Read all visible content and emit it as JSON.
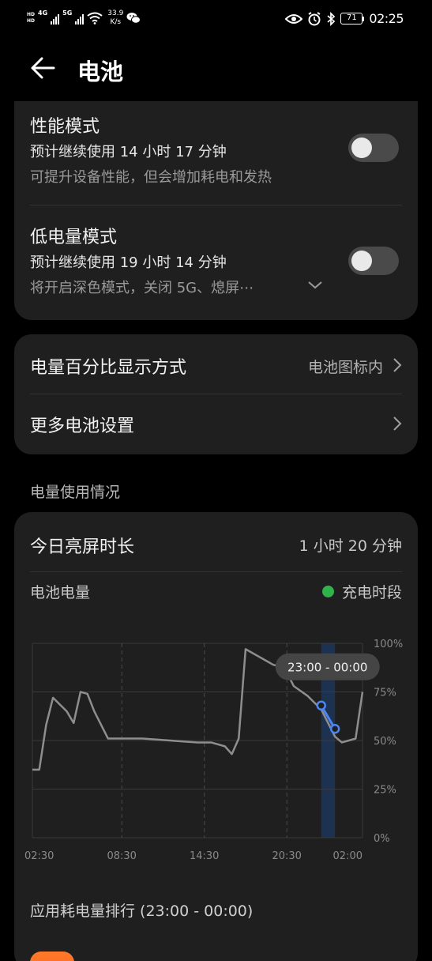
{
  "status_bar": {
    "hd1": "HD",
    "hd2": "HD",
    "sim1": "4G",
    "sim2": "5G",
    "speed_value": "33.9",
    "speed_unit": "K/s",
    "battery_level": "71",
    "time": "02:25"
  },
  "header": {
    "title": "电池"
  },
  "modes": {
    "performance": {
      "title": "性能模式",
      "estimate": "预计继续使用 14 小时 17 分钟",
      "description": "可提升设备性能，但会增加耗电和发热",
      "enabled": false
    },
    "low_power": {
      "title": "低电量模式",
      "estimate": "预计继续使用 19 小时 14 分钟",
      "description": "将开启深色模式，关闭 5G、熄屏⋯",
      "enabled": false
    }
  },
  "settings": {
    "percentage_label": "电量百分比显示方式",
    "percentage_value": "电池图标内",
    "more_label": "更多电池设置"
  },
  "usage": {
    "section_title": "电量使用情况",
    "screen_time_label": "今日亮屏时长",
    "screen_time_value": "1 小时 20 分钟",
    "battery_level_label": "电池电量",
    "charging_legend": "充电时段",
    "tooltip": "23:00 - 00:00",
    "rank_title": "应用耗电量排行 (23:00 - 00:00)"
  },
  "chart_data": {
    "type": "line",
    "title": "电池电量",
    "x_tick_labels": [
      "02:30",
      "08:30",
      "14:30",
      "20:30",
      "02:00"
    ],
    "y_tick_labels": [
      "100%",
      "75%",
      "50%",
      "25%",
      "0%"
    ],
    "ylim": [
      0,
      100
    ],
    "xlim_hours": [
      2.0,
      26.0
    ],
    "series": [
      {
        "name": "电池电量",
        "x": [
          2.0,
          2.5,
          3.0,
          3.5,
          4.5,
          5.0,
          5.5,
          6.0,
          6.5,
          7.5,
          8.5,
          10.0,
          12.0,
          14.0,
          15.0,
          16.0,
          16.5,
          17.0,
          17.5,
          18.5,
          19.0,
          19.5,
          20.0,
          20.5,
          21.0,
          22.0,
          23.0,
          24.0,
          24.5,
          25.0,
          25.5,
          26.0
        ],
        "y": [
          35,
          35,
          58,
          72,
          65,
          59,
          75,
          74,
          65,
          51,
          51,
          51,
          50,
          49,
          49,
          47,
          43,
          51,
          97,
          93,
          91,
          89,
          88,
          85,
          78,
          73,
          66,
          52,
          49,
          50,
          51,
          75
        ]
      },
      {
        "name": "23:00 - 00:00",
        "x": [
          23.0,
          24.0
        ],
        "y": [
          68,
          56
        ]
      }
    ],
    "highlight_range_hours": [
      23.0,
      24.0
    ],
    "grid": true
  }
}
